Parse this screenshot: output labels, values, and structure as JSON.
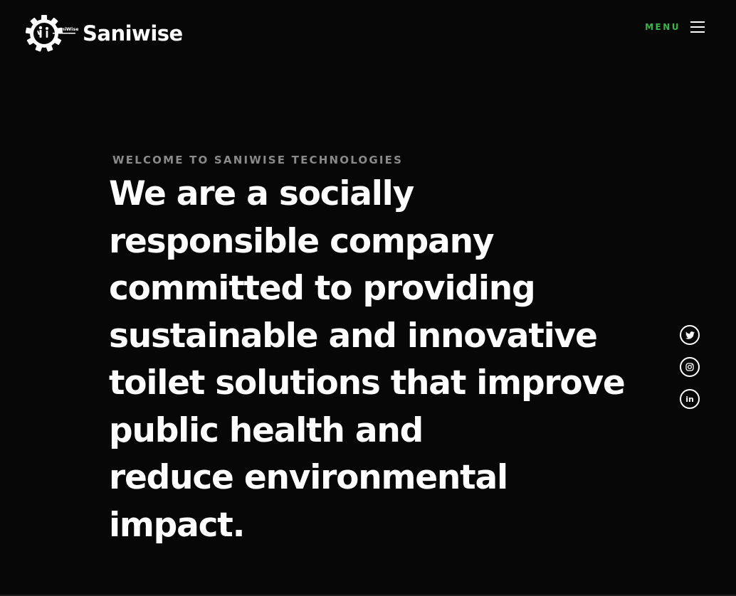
{
  "brand": {
    "name": "Saniwise",
    "logo_badge_text": "SaniWise"
  },
  "nav": {
    "menu_label": "MENU"
  },
  "hero": {
    "eyebrow": "WELCOME TO SANIWISE TECHNOLOGIES",
    "headline_lines": [
      "We are a socially",
      "responsible company",
      "committed to providing",
      "sustainable and innovative",
      "toilet solutions that improve",
      "public health and",
      "reduce environmental",
      "impact."
    ]
  },
  "social": {
    "items": [
      {
        "icon": "twitter-icon"
      },
      {
        "icon": "instagram-icon"
      },
      {
        "icon": "linkedin-icon",
        "label": "in"
      }
    ]
  },
  "colors": {
    "background": "#070707",
    "accent": "#3ab54a",
    "text": "#ffffff",
    "muted": "#8a8a8a"
  }
}
